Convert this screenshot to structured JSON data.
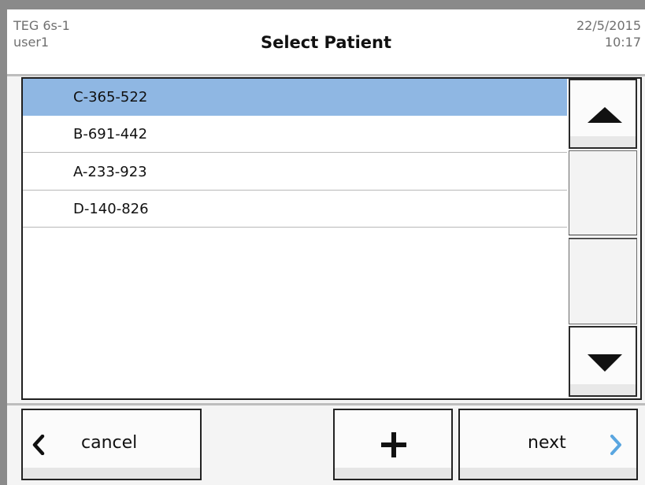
{
  "header": {
    "device": "TEG 6s-1",
    "user": "user1",
    "title": "Select Patient",
    "date": "22/5/2015",
    "time": "10:17"
  },
  "patients": [
    {
      "id": "C-365-522",
      "selected": true
    },
    {
      "id": "B-691-442",
      "selected": false
    },
    {
      "id": "A-233-923",
      "selected": false
    },
    {
      "id": "D-140-826",
      "selected": false
    }
  ],
  "buttons": {
    "cancel": "cancel",
    "add": "+",
    "next": "next"
  },
  "icons": {
    "scroll_up": "triangle-up-icon",
    "scroll_down": "triangle-down-icon",
    "back": "chevron-left-icon",
    "forward": "chevron-right-icon"
  },
  "colors": {
    "selected_row": "#8fb7e3",
    "next_chevron": "#5aa6e0"
  }
}
